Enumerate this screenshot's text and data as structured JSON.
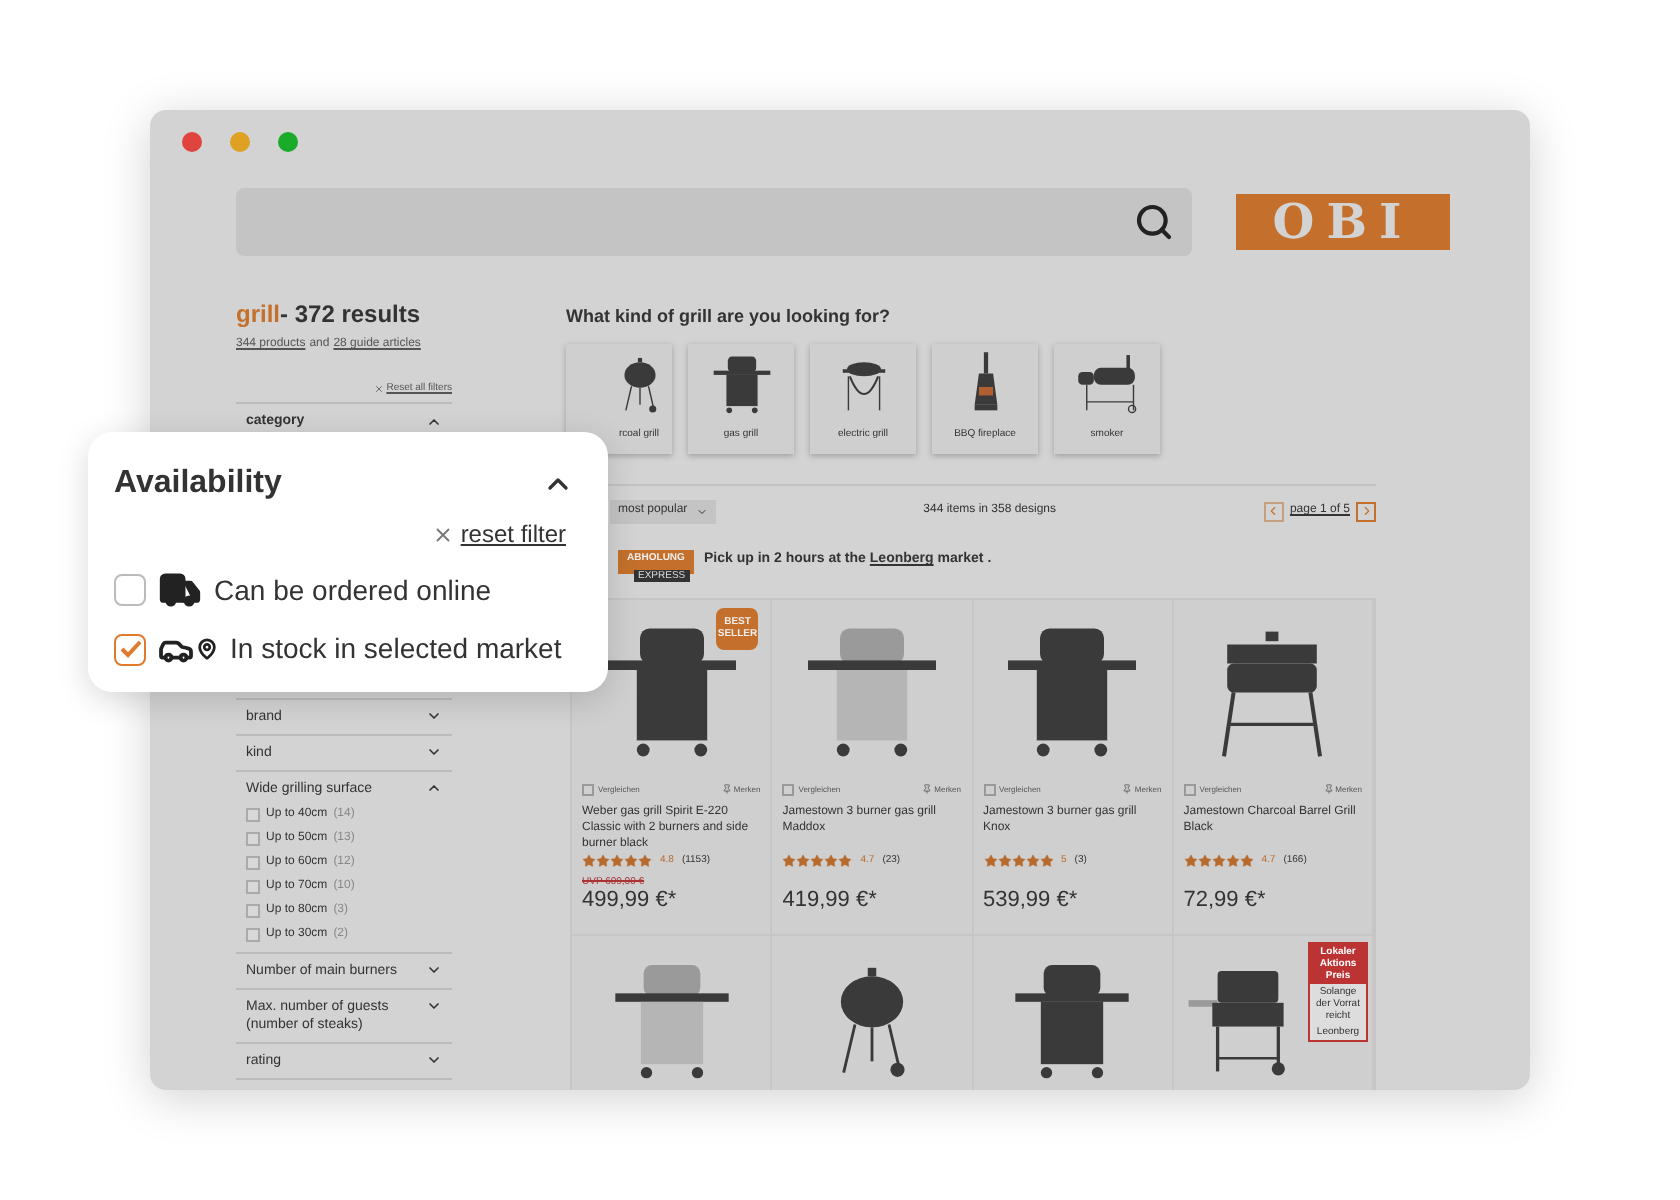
{
  "logo": {
    "text": "OBI"
  },
  "results": {
    "query": "grill",
    "title": "- 372 results",
    "products_link": "344 products",
    "joiner": "and",
    "articles_link": "28 guide articles"
  },
  "reset_all": "Reset all filters",
  "filters_top": [
    {
      "label": "category",
      "expanded": true
    }
  ],
  "filters": [
    {
      "label": "brand",
      "expanded": false
    },
    {
      "label": "kind",
      "expanded": false
    },
    {
      "label": "Wide grilling surface",
      "expanded": true,
      "options": [
        {
          "label": "Up to 40cm",
          "count": "(14)",
          "checked": false
        },
        {
          "label": "Up to 50cm",
          "count": "(13)",
          "checked": false
        },
        {
          "label": "Up to 60cm",
          "count": "(12)",
          "checked": false
        },
        {
          "label": "Up to 70cm",
          "count": "(10)",
          "checked": false
        },
        {
          "label": "Up to 80cm",
          "count": "(3)",
          "checked": false
        },
        {
          "label": "Up to 30cm",
          "count": "(2)",
          "checked": false
        }
      ]
    },
    {
      "label": "Number of main burners",
      "expanded": false
    },
    {
      "label": "Max. number of guests (number of steaks)",
      "expanded": false
    },
    {
      "label": "rating",
      "expanded": false
    }
  ],
  "availability": {
    "title": "Availability",
    "expanded": true,
    "reset": "reset filter",
    "options": [
      {
        "kind": "delivery",
        "label": "Can be ordered online",
        "checked": false
      },
      {
        "kind": "market",
        "label": "In stock in selected market",
        "checked": true
      }
    ]
  },
  "grill_types": {
    "heading": "What kind of grill are you looking for?",
    "items": [
      {
        "kind": "kettle",
        "label": "rcoal grill"
      },
      {
        "kind": "gas",
        "label": "gas grill"
      },
      {
        "kind": "electric",
        "label": "electric grill"
      },
      {
        "kind": "fireplace",
        "label": "BBQ fireplace"
      },
      {
        "kind": "smoker",
        "label": "smoker"
      }
    ]
  },
  "toolbar": {
    "sort": "most popular",
    "count": "344 items in 358 designs",
    "page": "page 1 of 5"
  },
  "pickup": {
    "badge": "ABHOLUNG",
    "badge_sub": "EXPRESS",
    "before": "Pick up in 2 hours at the",
    "market": "Leonberg",
    "after": "market ."
  },
  "products": [
    {
      "kind": "gas",
      "badge": "BEST SELLER",
      "compare_checked": false,
      "compare": "Vergleichen",
      "remember": "Merken",
      "name": "Weber gas grill Spirit E-220 Classic with 2 burners and side burner black",
      "stars": 5,
      "rating": "4.8",
      "reviews": "(1153)",
      "old_price": "UVP 609,00 €",
      "price": "499,99 €*"
    },
    {
      "kind": "steel",
      "compare_checked": false,
      "compare": "Vergleichen",
      "remember": "Merken",
      "name": "Jamestown 3 burner gas grill Maddox",
      "stars": 5,
      "rating": "4.7",
      "reviews": "(23)",
      "price": "419,99 €*"
    },
    {
      "kind": "gas",
      "compare_checked": false,
      "compare": "Vergleichen",
      "remember": "Merken",
      "name": "Jamestown 3 burner gas grill Knox",
      "stars": 5,
      "rating": "5",
      "reviews": "(3)",
      "price": "539,99 €*"
    },
    {
      "kind": "barrel",
      "compare_checked": false,
      "compare": "Vergleichen",
      "remember": "Merken",
      "name": "Jamestown Charcoal Barrel Grill Black",
      "stars": 5,
      "rating": "4.7",
      "reviews": "(166)",
      "price": "72,99 €*"
    }
  ],
  "products_row2": [
    {
      "kind": "steel"
    },
    {
      "kind": "kettle"
    },
    {
      "kind": "gas"
    },
    {
      "kind": "cart",
      "badge": [
        "Lokaler Aktions Preis",
        "Solange der Vorrat reicht",
        "Leonberg"
      ]
    }
  ]
}
